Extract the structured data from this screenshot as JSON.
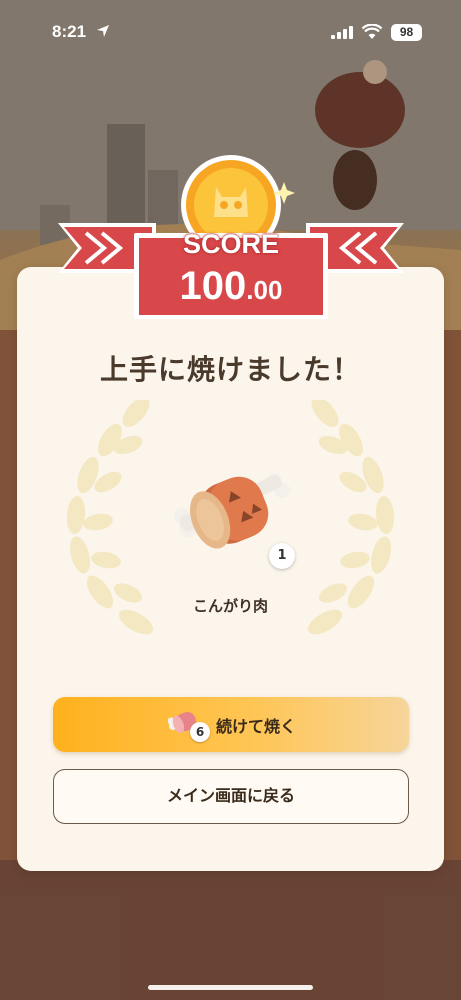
{
  "status_bar": {
    "time": "8:21",
    "battery": "98"
  },
  "score": {
    "label": "SCORE",
    "value_int": "100",
    "value_dec": ".00"
  },
  "result": {
    "title": "上手に焼けました！"
  },
  "reward": {
    "item_name": "こんがり肉",
    "count": "1",
    "icon": "meat-icon"
  },
  "actions": {
    "continue_label": "続けて焼く",
    "continue_count": "6",
    "home_label": "メイン画面に戻る"
  },
  "colors": {
    "banner_red": "#d8474a",
    "card_bg": "#fbf5ec",
    "primary_button": "#ffb11d",
    "title_text": "#4a3a2c"
  }
}
